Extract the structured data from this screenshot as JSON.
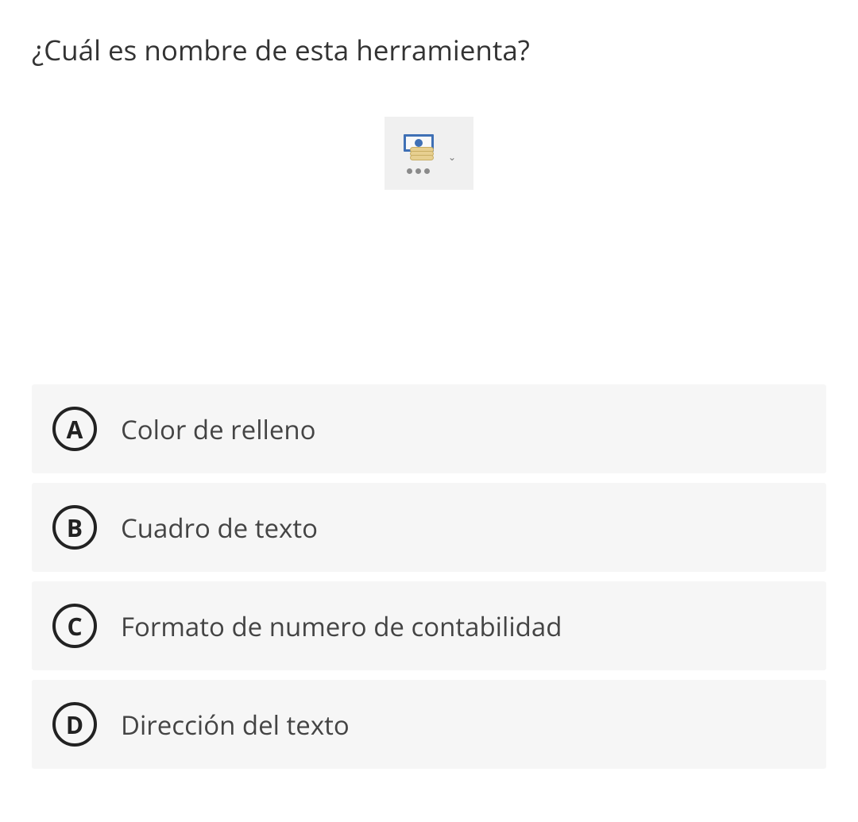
{
  "question": "¿Cuál es nombre de esta herramienta?",
  "tool_icon": "accounting-number-format-icon",
  "answers": [
    {
      "letter": "A",
      "text": "Color de relleno"
    },
    {
      "letter": "B",
      "text": "Cuadro de texto"
    },
    {
      "letter": "C",
      "text": "Formato de numero de contabilidad"
    },
    {
      "letter": "D",
      "text": "Dirección del texto"
    }
  ]
}
